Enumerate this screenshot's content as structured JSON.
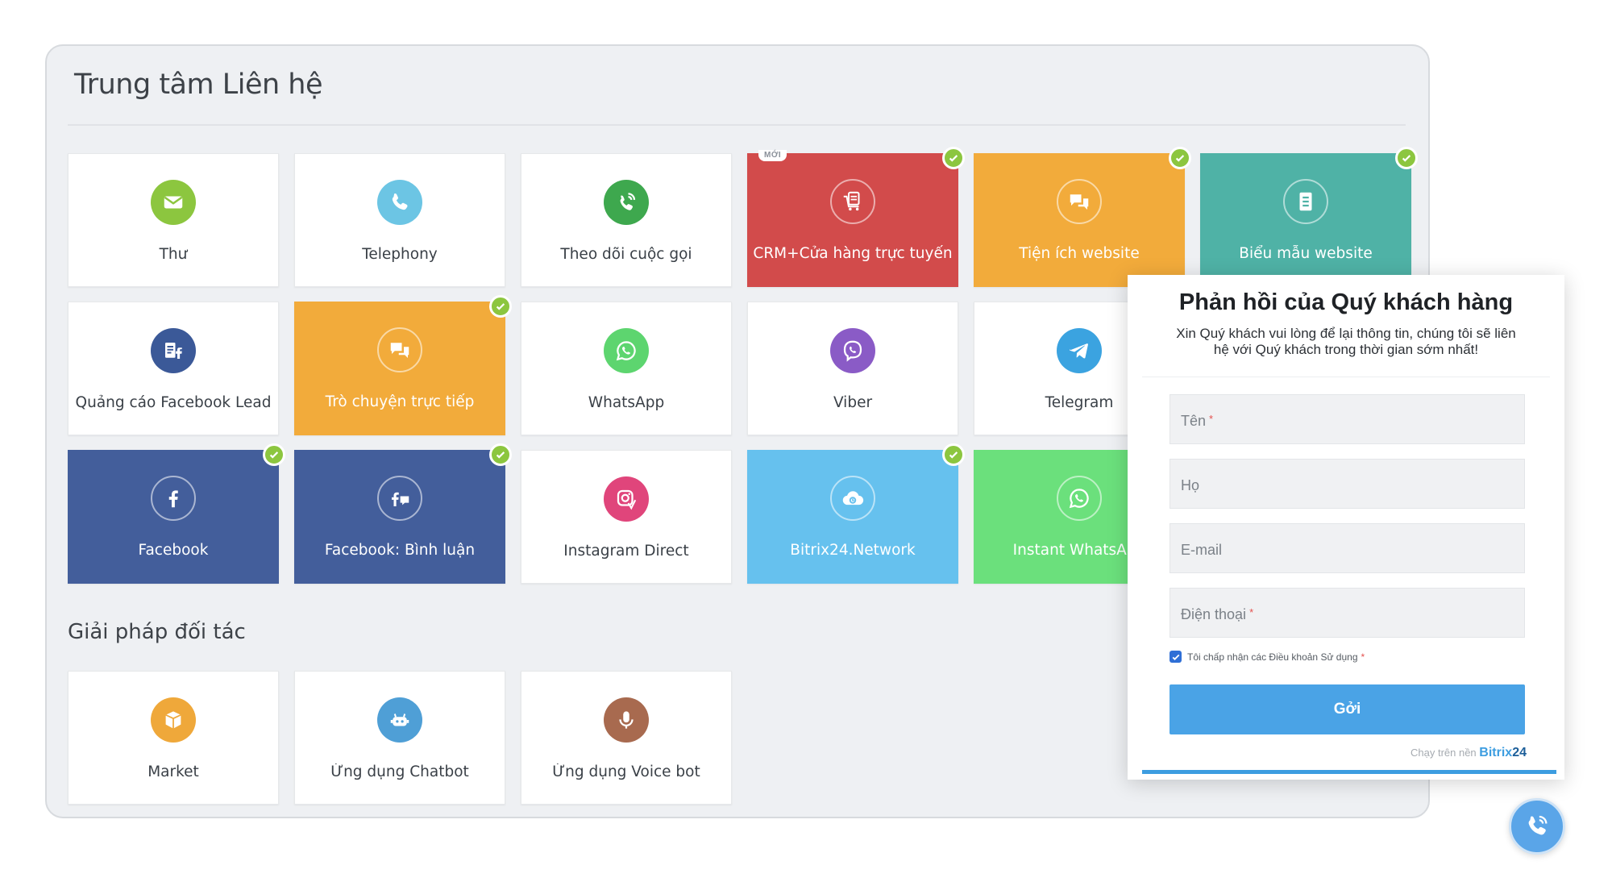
{
  "panel": {
    "title": "Trung tâm Liên hệ"
  },
  "tiles": [
    {
      "label": "Thư",
      "icon": "mail-icon",
      "color": "#8cc63f",
      "filled": false,
      "checked": false
    },
    {
      "label": "Telephony",
      "icon": "phone-icon",
      "color": "#6cc5e4",
      "filled": false,
      "checked": false
    },
    {
      "label": "Theo dõi cuộc gọi",
      "icon": "call-tracking-icon",
      "color": "#3ea84e",
      "filled": false,
      "checked": false
    },
    {
      "label": "CRM+Cửa hàng trực tuyến",
      "icon": "cart-icon",
      "color": "#d24b4b",
      "filled": true,
      "checked": true,
      "badge": "MỚI"
    },
    {
      "label": "Tiện ích website",
      "icon": "chat-bubbles-icon",
      "color": "#f2ab3b",
      "filled": true,
      "checked": true
    },
    {
      "label": "Biểu mẫu website",
      "icon": "form-icon",
      "color": "#4fb2a6",
      "filled": true,
      "checked": true
    },
    {
      "label": "Quảng cáo Facebook Lead",
      "icon": "facebook-lead-icon",
      "color": "#3b5998",
      "filled": false,
      "checked": false
    },
    {
      "label": "Trò chuyện trực tiếp",
      "icon": "chat-bubbles-icon",
      "color": "#f2ab3b",
      "filled": true,
      "checked": true
    },
    {
      "label": "WhatsApp",
      "icon": "whatsapp-icon",
      "color": "#5dd56f",
      "filled": false,
      "checked": false
    },
    {
      "label": "Viber",
      "icon": "viber-icon",
      "color": "#8a5bc6",
      "filled": false,
      "checked": false
    },
    {
      "label": "Telegram",
      "icon": "telegram-icon",
      "color": "#3ba3e0",
      "filled": false,
      "checked": false
    },
    {
      "label": "Facebook",
      "icon": "facebook-icon",
      "color": "#435e9b",
      "filled": true,
      "checked": true
    },
    {
      "label": "Facebook: Bình luận",
      "icon": "facebook-comments-icon",
      "color": "#435e9b",
      "filled": true,
      "checked": true
    },
    {
      "label": "Instagram Direct",
      "icon": "instagram-icon",
      "color": "#e0457b",
      "filled": false,
      "checked": false
    },
    {
      "label": "Bitrix24.Network",
      "icon": "cloud-icon",
      "color": "#66c1ee",
      "filled": true,
      "checked": true
    },
    {
      "label": "Instant WhatsApp",
      "icon": "whatsapp-icon",
      "color": "#6be07c",
      "filled": true,
      "checked": false
    }
  ],
  "partners": {
    "title": "Giải pháp đối tác",
    "tiles": [
      {
        "label": "Market",
        "icon": "box-icon",
        "color": "#efa83a"
      },
      {
        "label": "Ứng dụng Chatbot",
        "icon": "robot-icon",
        "color": "#4f9fd6"
      },
      {
        "label": "Ứng dụng Voice bot",
        "icon": "microphone-icon",
        "color": "#a86a4f"
      }
    ]
  },
  "form": {
    "title": "Phản hồi của Quý khách hàng",
    "subtitle": "Xin Quý khách vui lòng để lại thông tin, chúng tôi sẽ liên hệ với Quý khách trong thời gian sớm nhất!",
    "fields": [
      {
        "placeholder": "Tên",
        "required": "*"
      },
      {
        "placeholder": "Họ",
        "required": ""
      },
      {
        "placeholder": "E-mail",
        "required": ""
      },
      {
        "placeholder": "Điện thoại",
        "required": "*"
      }
    ],
    "consent": "Tôi chấp nhận các Điều khoản Sử dụng",
    "consent_required": "*",
    "submit": "Gởi",
    "powered_prefix": "Chạy trên nền",
    "powered_brand": "Bitrix",
    "powered_brand_num": "24"
  },
  "colors": {
    "check": "#8cc63f",
    "accent": "#4aa3e6"
  }
}
